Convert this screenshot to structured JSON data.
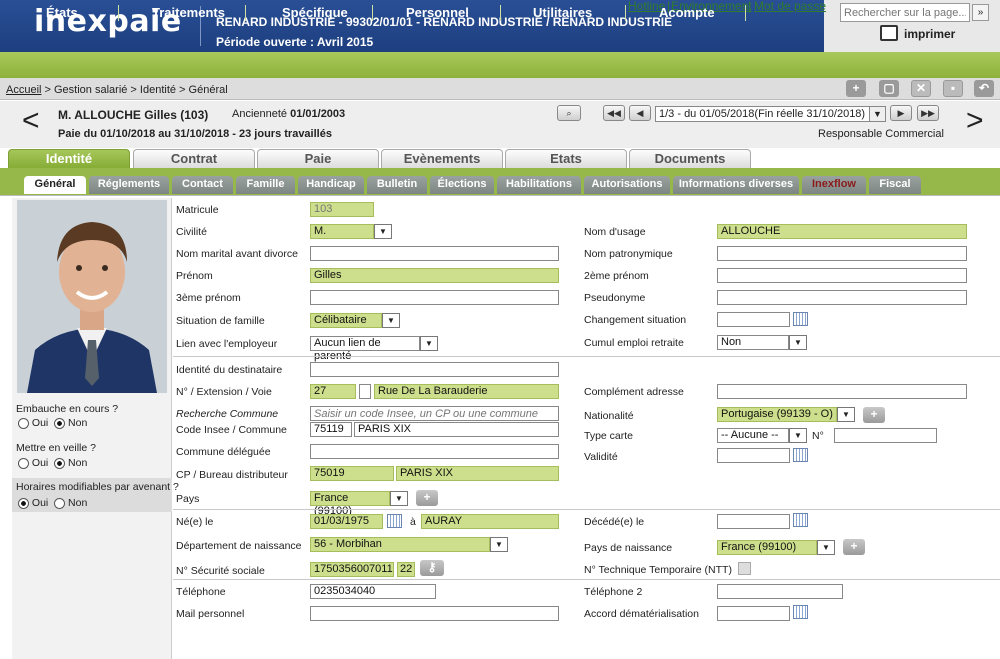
{
  "app": {
    "logo": "inexpaie",
    "company": "RENARD INDUSTRIE - 99302/01/01 - RENARD INDUSTRIE / RENARD INDUSTRIE",
    "period": "Période ouverte : Avril 2015"
  },
  "toplinks": {
    "hotline": "Hotline",
    "env": "Environnement",
    "pwd": "Mot de passe"
  },
  "search": {
    "placeholder": "Rechercher sur la page..."
  },
  "print_label": "imprimer",
  "nav": [
    "États",
    "Traitements",
    "Spécifique",
    "Personnel",
    "Utilitaires",
    "Acompte"
  ],
  "breadcrumb": {
    "home": "Accueil",
    "rest": " > Gestion salarié > Identité > Général"
  },
  "employee": {
    "name": "M. ALLOUCHE  Gilles  (103)",
    "anciennete_label": "Ancienneté",
    "anciennete": "01/01/2003",
    "paie": "Paie du 01/10/2018 au 31/10/2018 - 23 jours travaillés",
    "role": "Responsable Commercial",
    "period_select": "1/3 - du 01/05/2018(Fin réelle 31/10/2018)"
  },
  "main_tabs": [
    "Identité",
    "Contrat",
    "Paie",
    "Evènements",
    "Etats",
    "Documents"
  ],
  "sub_tabs": [
    "Général",
    "Réglements",
    "Contact",
    "Famille",
    "Handicap",
    "Bulletin",
    "Élections",
    "Habilitations",
    "Autorisations",
    "Informations diverses",
    "Inexflow",
    "Fiscal"
  ],
  "left": {
    "embauche": "Embauche en cours ?",
    "veille": "Mettre en veille ?",
    "horaires": "Horaires modifiables par avenant ?",
    "oui": "Oui",
    "non": "Non",
    "embauche_val": "Non",
    "veille_val": "Non",
    "horaires_val": "Oui"
  },
  "form": {
    "matricule_l": "Matricule",
    "matricule": "103",
    "civilite_l": "Civilité",
    "civilite": "M.",
    "nom_usage_l": "Nom d'usage",
    "nom_usage": "ALLOUCHE",
    "nom_marital_l": "Nom marital avant divorce",
    "nom_patro_l": "Nom patronymique",
    "prenom_l": "Prénom",
    "prenom": "Gilles",
    "prenom2_l": "2ème prénom",
    "prenom3_l": "3ème prénom",
    "pseudo_l": "Pseudonyme",
    "sit_l": "Situation de famille",
    "sit": "Célibataire",
    "chg_l": "Changement situation",
    "lien_l": "Lien avec l'employeur",
    "lien": "Aucun lien de parenté",
    "cumul_l": "Cumul emploi retraite",
    "cumul": "Non",
    "dest_l": "Identité du destinataire",
    "voie_l": "N° / Extension / Voie",
    "voie_num": "27",
    "voie": "Rue De La Barauderie",
    "compl_l": "Complément adresse",
    "rech_l": "Recherche Commune",
    "rech_ph": "Saisir un code Insee, un CP ou une commune",
    "nat_l": "Nationalité",
    "nat": "Portugaise (99139 - O)",
    "insee_l": "Code Insee / Commune",
    "insee": "75119",
    "commune": "PARIS XIX",
    "carte_l": "Type carte",
    "carte": "-- Aucune --",
    "no_l": "N°",
    "deleg_l": "Commune déléguée",
    "valid_l": "Validité",
    "cp_l": "CP / Bureau distributeur",
    "cp": "75019",
    "bureau": "PARIS XIX",
    "pays_l": "Pays",
    "pays": "France (99100)",
    "ne_l": "Né(e) le",
    "ne": "01/03/1975",
    "a_l": "à",
    "ne_lieu": "AURAY",
    "dece_l": "Décédé(e) le",
    "dep_l": "Département de naissance",
    "dep": "56 - Morbihan",
    "paysn_l": "Pays de naissance",
    "paysn": "France (99100)",
    "secu_l": "N° Sécurité sociale",
    "secu": "1750356007011",
    "cle": "22",
    "ntt_l": "N° Technique Temporaire (NTT)",
    "tel_l": "Téléphone",
    "tel": "0235034040",
    "tel2_l": "Téléphone 2",
    "mail_l": "Mail personnel",
    "accord_l": "Accord dématérialisation"
  }
}
